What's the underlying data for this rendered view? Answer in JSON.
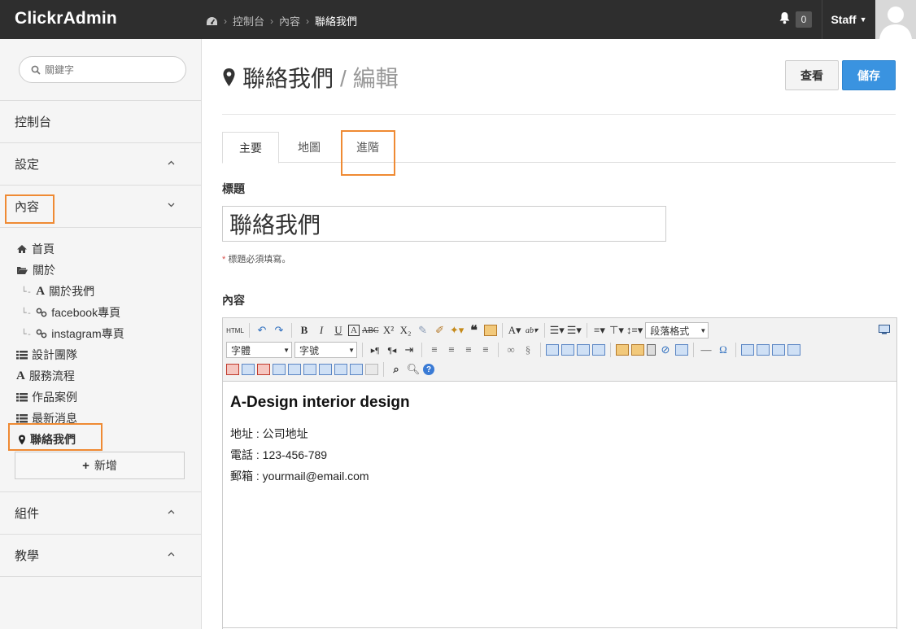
{
  "app": {
    "brand": "ClickrAdmin"
  },
  "breadcrumb": {
    "items": [
      "控制台",
      "內容",
      "聯絡我們"
    ]
  },
  "header": {
    "notifications": "0",
    "user": "Staff"
  },
  "sidebar": {
    "search_placeholder": "關鍵字",
    "nav": [
      {
        "label": "控制台"
      },
      {
        "label": "設定"
      },
      {
        "label": "內容"
      },
      {
        "label": "組件"
      },
      {
        "label": "教學"
      }
    ],
    "content_items": [
      {
        "label": "首頁"
      },
      {
        "label": "關於"
      },
      {
        "label": "關於我們"
      },
      {
        "label": "facebook專頁"
      },
      {
        "label": "instagram專頁"
      },
      {
        "label": "設計團隊"
      },
      {
        "label": "服務流程"
      },
      {
        "label": "作品案例"
      },
      {
        "label": "最新消息"
      },
      {
        "label": "聯絡我們"
      }
    ],
    "add_label": "新增"
  },
  "page": {
    "title": "聯絡我們",
    "subtitle": "/ 編輯",
    "view_label": "查看",
    "save_label": "儲存",
    "tabs": [
      {
        "label": "主要"
      },
      {
        "label": "地圖"
      },
      {
        "label": "進階"
      }
    ],
    "title_label": "標題",
    "title_value": "聯絡我們",
    "title_hint_req": "*",
    "title_hint": "標題必須填寫。",
    "content_label": "內容"
  },
  "editor": {
    "html_label": "HTML",
    "paragraph_format": "段落格式",
    "font_family": "字體",
    "font_size": "字號",
    "content": {
      "heading": "A-Design interior design",
      "lines": [
        "地址 : 公司地址",
        "電話 : 123-456-789",
        "郵箱 : yourmail@email.com"
      ]
    }
  },
  "colors": {
    "topbar": "#2e2e2e",
    "primary": "#3a93e0",
    "highlight": "#ef8a33"
  }
}
